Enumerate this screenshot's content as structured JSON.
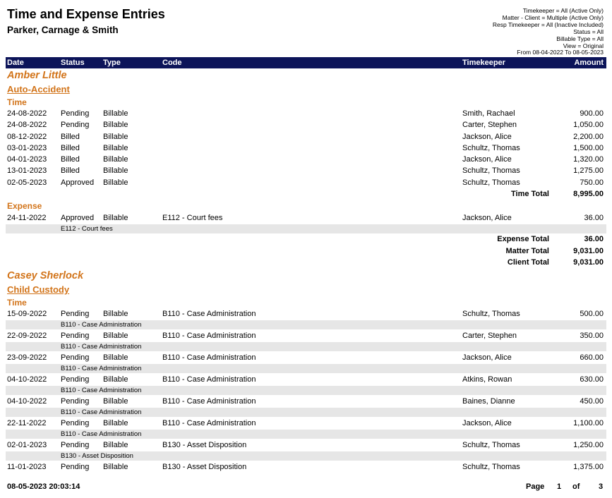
{
  "report": {
    "title": "Time and Expense Entries",
    "firm": "Parker, Carnage & Smith",
    "filters": [
      "Timekeeper = All (Active Only)",
      "Matter - Client = Multiple (Active Only)",
      "Resp Timekeeper = All (Inactive Included)",
      "Status = All",
      "Billable Type = All",
      "View = Original",
      "From 08-04-2022 To 08-05-2023"
    ]
  },
  "columns": {
    "date": "Date",
    "status": "Status",
    "type": "Type",
    "code": "Code",
    "timekeeper": "Timekeeper",
    "amount": "Amount"
  },
  "clients": [
    {
      "name": "Amber Little",
      "matter": "Auto-Accident",
      "time_label": "Time",
      "time_rows": [
        {
          "date": "24-08-2022",
          "status": "Pending",
          "type": "Billable",
          "code": "",
          "timekeeper": "Smith, Rachael",
          "amount": "900.00"
        },
        {
          "date": "24-08-2022",
          "status": "Pending",
          "type": "Billable",
          "code": "",
          "timekeeper": "Carter, Stephen",
          "amount": "1,050.00"
        },
        {
          "date": "08-12-2022",
          "status": "Billed",
          "type": "Billable",
          "code": "",
          "timekeeper": "Jackson, Alice",
          "amount": "2,200.00"
        },
        {
          "date": "03-01-2023",
          "status": "Billed",
          "type": "Billable",
          "code": "",
          "timekeeper": "Schultz, Thomas",
          "amount": "1,500.00"
        },
        {
          "date": "04-01-2023",
          "status": "Billed",
          "type": "Billable",
          "code": "",
          "timekeeper": "Jackson, Alice",
          "amount": "1,320.00"
        },
        {
          "date": "13-01-2023",
          "status": "Billed",
          "type": "Billable",
          "code": "",
          "timekeeper": "Schultz, Thomas",
          "amount": "1,275.00"
        },
        {
          "date": "02-05-2023",
          "status": "Approved",
          "type": "Billable",
          "code": "",
          "timekeeper": "Schultz, Thomas",
          "amount": "750.00"
        }
      ],
      "time_total_label": "Time Total",
      "time_total": "8,995.00",
      "expense_label": "Expense",
      "expense_rows": [
        {
          "date": "24-11-2022",
          "status": "Approved",
          "type": "Billable",
          "code": "E112 - Court fees",
          "timekeeper": "Jackson, Alice",
          "amount": "36.00",
          "desc": "E112 - Court fees"
        }
      ],
      "expense_total_label": "Expense Total",
      "expense_total": "36.00",
      "matter_total_label": "Matter Total",
      "matter_total": "9,031.00",
      "client_total_label": "Client Total",
      "client_total": "9,031.00"
    },
    {
      "name": "Casey Sherlock",
      "matter": "Child Custody",
      "time_label": "Time",
      "time_rows": [
        {
          "date": "15-09-2022",
          "status": "Pending",
          "type": "Billable",
          "code": "B110 - Case Administration",
          "timekeeper": "Schultz, Thomas",
          "amount": "500.00",
          "desc": "B110 - Case Administration"
        },
        {
          "date": "22-09-2022",
          "status": "Pending",
          "type": "Billable",
          "code": "B110 - Case Administration",
          "timekeeper": "Carter, Stephen",
          "amount": "350.00",
          "desc": "B110 - Case Administration"
        },
        {
          "date": "23-09-2022",
          "status": "Pending",
          "type": "Billable",
          "code": "B110 - Case Administration",
          "timekeeper": "Jackson, Alice",
          "amount": "660.00",
          "desc": "B110 - Case Administration"
        },
        {
          "date": "04-10-2022",
          "status": "Pending",
          "type": "Billable",
          "code": "B110 - Case Administration",
          "timekeeper": "Atkins, Rowan",
          "amount": "630.00",
          "desc": "B110 - Case Administration"
        },
        {
          "date": "04-10-2022",
          "status": "Pending",
          "type": "Billable",
          "code": "B110 - Case Administration",
          "timekeeper": "Baines, Dianne",
          "amount": "450.00",
          "desc": "B110 - Case Administration"
        },
        {
          "date": "22-11-2022",
          "status": "Pending",
          "type": "Billable",
          "code": "B110 - Case Administration",
          "timekeeper": "Jackson, Alice",
          "amount": "1,100.00",
          "desc": "B110 - Case Administration"
        },
        {
          "date": "02-01-2023",
          "status": "Pending",
          "type": "Billable",
          "code": "B130 - Asset Disposition",
          "timekeeper": "Schultz, Thomas",
          "amount": "1,250.00",
          "desc": "B130 - Asset Disposition"
        },
        {
          "date": "11-01-2023",
          "status": "Pending",
          "type": "Billable",
          "code": "B130 - Asset Disposition",
          "timekeeper": "Schultz, Thomas",
          "amount": "1,375.00"
        }
      ]
    }
  ],
  "footer": {
    "timestamp": "08-05-2023 20:03:14",
    "page_label": "Page",
    "page": "1",
    "of_label": "of",
    "total_pages": "3"
  }
}
